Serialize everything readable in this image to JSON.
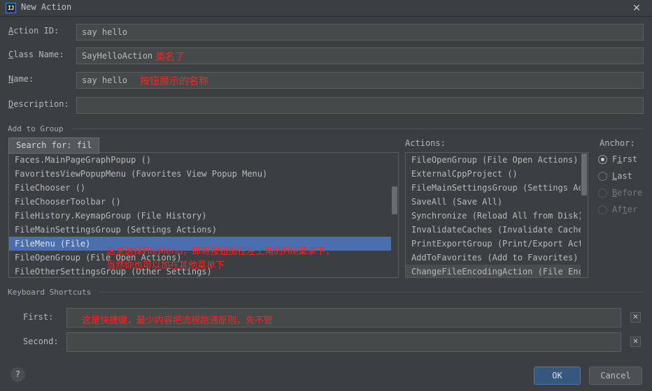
{
  "window": {
    "title": "New Action",
    "app_icon": "IJ",
    "close_icon": "✕"
  },
  "colors": {
    "background": "#3c3f41",
    "field_bg": "#45494a",
    "selection": "#4b6eaf",
    "annotation_red": "#ff2222",
    "ok_button": "#365880",
    "text": "#bbbbbb"
  },
  "fields": [
    {
      "label_prefix": "A",
      "label_rest": "ction ID:",
      "value": "say hello",
      "name": "action-id"
    },
    {
      "label_prefix": "C",
      "label_rest": "lass Name:",
      "value": "SayHelloAction",
      "name": "class-name"
    },
    {
      "label_prefix": "N",
      "label_rest": "ame:",
      "value": "say hello",
      "name": "name"
    },
    {
      "label_prefix": "D",
      "label_rest": "escription:",
      "value": "",
      "name": "description"
    }
  ],
  "annotations": {
    "class_name_note": "类名了",
    "name_note": "按钮展示的名称",
    "list_note_line1": "这里选择FileMenu，即将按钮加在左上角的File菜单下，",
    "list_note_line2": "当然你也可以加在其他菜单下",
    "shortcut_note": "这是快捷键，最少内容把流程跑通原则，先不管"
  },
  "add_to_group": {
    "title": "Add to Group",
    "search_popup": "Search for:  fil",
    "groups_list": [
      {
        "text": "Faces.MainPageGraphPopup ()",
        "selected": false
      },
      {
        "text": "FavoritesViewPopupMenu (Favorites View Popup Menu)",
        "selected": false
      },
      {
        "text": "FileChooser ()",
        "selected": false
      },
      {
        "text": "FileChooserToolbar ()",
        "selected": false
      },
      {
        "text": "FileHistory.KeymapGroup (File History)",
        "selected": false
      },
      {
        "text": "FileMainSettingsGroup (Settings Actions)",
        "selected": false
      },
      {
        "text": "FileMenu (File)",
        "selected": true
      },
      {
        "text": "FileOpenGroup (File Open Actions)",
        "selected": false
      },
      {
        "text": "FileOtherSettingsGroup (Other Settings)",
        "selected": false
      }
    ],
    "actions_label": "Actions:",
    "actions_list": [
      {
        "text": "FileOpenGroup (File Open Actions)",
        "faint": false
      },
      {
        "text": "ExternalCppProject ()",
        "faint": false
      },
      {
        "text": "FileMainSettingsGroup (Settings Act:",
        "faint": false
      },
      {
        "text": "SaveAll (Save All)",
        "faint": false
      },
      {
        "text": "Synchronize (Reload All from Disk)",
        "faint": false
      },
      {
        "text": "InvalidateCaches (Invalidate Caches",
        "faint": false
      },
      {
        "text": "PrintExportGroup (Print/Export Actio",
        "faint": false
      },
      {
        "text": "AddToFavorites (Add to Favorites)",
        "faint": false
      },
      {
        "text": "ChangeFileEncodingAction (File Enco",
        "faint": true
      }
    ],
    "anchor_label": "Anchor:",
    "anchor_options": [
      {
        "prefix": "F",
        "underline": "i",
        "suffix": "rst",
        "selected": true,
        "disabled": false
      },
      {
        "prefix": "",
        "underline": "L",
        "suffix": "ast",
        "selected": false,
        "disabled": false
      },
      {
        "prefix": "",
        "underline": "B",
        "suffix": "efore",
        "selected": false,
        "disabled": true
      },
      {
        "prefix": "Af",
        "underline": "t",
        "suffix": "er",
        "selected": false,
        "disabled": true
      }
    ]
  },
  "keyboard_shortcuts": {
    "title": "Keyboard Shortcuts",
    "first_label": "First:",
    "first_value": "",
    "second_label": "Second:",
    "second_value": "",
    "clear_icon": "✕"
  },
  "footer": {
    "help_icon": "?",
    "ok_label": "OK",
    "cancel_label": "Cancel"
  }
}
